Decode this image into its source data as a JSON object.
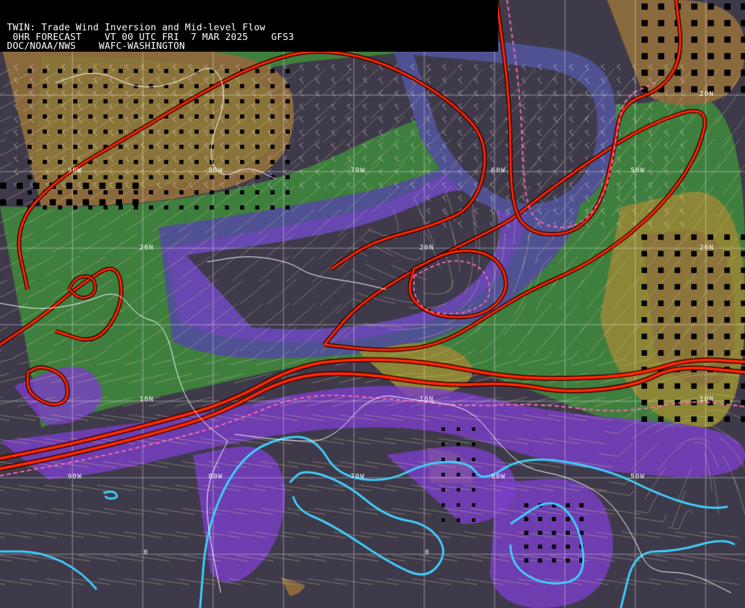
{
  "header": {
    "line1": "TWIN: Trade Wind Inversion and Mid-level Flow",
    "line2": " 0HR FORECAST    VT 00 UTC FRI  7 MAR 2025    GFS3",
    "line3": "DOC/NOAA/NWS    WAFC-WASHINGTON"
  },
  "grid_labels": {
    "lat_20n": "20N",
    "lat_10n": "10N",
    "lat_0": "0",
    "lon_90w": "90W",
    "lon_80w": "80W",
    "lon_70w": "70W",
    "lon_60w": "60W",
    "lon_50w": "50W"
  },
  "colors": {
    "ocean_base": "#3e3a4a",
    "purple": "#7b3fc8",
    "slate": "#4f5192",
    "green": "#3f7f3e",
    "olive": "#8c8636",
    "brown": "#8a6a3d",
    "red_contour": "#ff2a00",
    "pink_dash": "#ff6ab4",
    "cyan_contour": "#3fd0ff",
    "coast": "#ffffff",
    "streamline": "#d8cf9a"
  }
}
